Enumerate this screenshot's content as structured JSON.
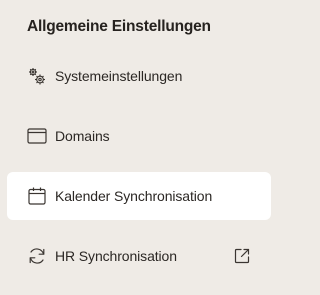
{
  "sidebar": {
    "heading": "Allgemeine Einstellungen",
    "active_background": "#ffffff",
    "items": [
      {
        "label": "Systemeinstellungen",
        "icon": "gears-icon"
      },
      {
        "label": "Domains",
        "icon": "browser-window-icon"
      },
      {
        "label": "Kalender Synchronisation",
        "icon": "calendar-icon",
        "active": true
      },
      {
        "label": "HR Synchronisation",
        "icon": "sync-arrows-icon",
        "trailing_icon": "external-link-icon"
      }
    ]
  }
}
